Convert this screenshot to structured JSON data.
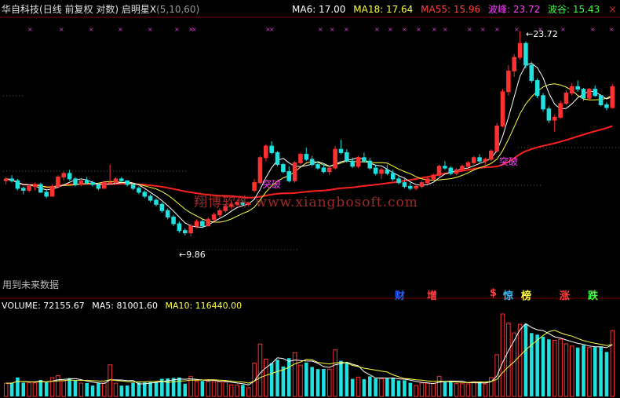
{
  "header": {
    "stock_name": "华自科技",
    "mode": "(日线 前复权 对数)",
    "indicator_name": "启明星X",
    "indicator_params": "(5,10,60)",
    "ma6": "MA6: 17.00",
    "ma18": "MA18: 17.64",
    "ma55": "MA55: 15.96",
    "peak": "波峰: 23.72",
    "trough": "波谷: 15.43"
  },
  "colors": {
    "background": "#000000",
    "up": "#ff3030",
    "down": "#20e0e0",
    "ma55": "#ff2020",
    "ma_short": "#ffffff",
    "ma_mid": "#ffff40",
    "marker": "#d040d0"
  },
  "price_labels": {
    "high": "23.72",
    "low": "9.86",
    "breakout1": "突破",
    "breakout2": "突破"
  },
  "future_note": "用到未来数据",
  "signals": [
    {
      "text": "财",
      "color": "#2060ff"
    },
    {
      "text": "增",
      "color": "#ff4040"
    },
    {
      "text": "$",
      "color": "#ff4040"
    },
    {
      "text": "惊",
      "color": "#40c0ff"
    },
    {
      "text": "榜",
      "color": "#ffff40"
    },
    {
      "text": "涨",
      "color": "#ff4040"
    },
    {
      "text": "跌",
      "color": "#40ff40"
    }
  ],
  "volume": {
    "label": "VOLUME: 72155.67",
    "ma5": "MA5: 81001.60",
    "ma10": "MA10: 116440.00"
  },
  "watermark": "翔博软件 www.xiangbosoft.com",
  "close_icon": "×",
  "chart_data": {
    "type": "candlestick",
    "ylim": [
      9.0,
      25.0
    ],
    "ohlc": [
      [
        12.5,
        12.7,
        12.3,
        12.6
      ],
      [
        12.6,
        12.8,
        12.4,
        12.5
      ],
      [
        12.5,
        12.6,
        12.0,
        12.1
      ],
      [
        12.1,
        12.2,
        11.8,
        12.0
      ],
      [
        12.0,
        12.3,
        11.9,
        12.2
      ],
      [
        12.2,
        12.4,
        12.0,
        12.3
      ],
      [
        12.3,
        12.4,
        11.9,
        11.9
      ],
      [
        11.9,
        12.0,
        11.6,
        11.7
      ],
      [
        11.7,
        12.3,
        11.7,
        12.2
      ],
      [
        12.2,
        12.8,
        12.1,
        12.7
      ],
      [
        12.7,
        13.0,
        12.5,
        12.9
      ],
      [
        12.9,
        13.1,
        12.5,
        12.6
      ],
      [
        12.6,
        12.7,
        12.2,
        12.3
      ],
      [
        12.3,
        12.6,
        12.2,
        12.5
      ],
      [
        12.5,
        12.7,
        12.3,
        12.4
      ],
      [
        12.4,
        12.5,
        12.2,
        12.3
      ],
      [
        12.3,
        12.4,
        12.0,
        12.1
      ],
      [
        12.1,
        12.5,
        12.1,
        12.4
      ],
      [
        12.4,
        13.4,
        12.3,
        12.4
      ],
      [
        12.4,
        12.7,
        12.3,
        12.6
      ],
      [
        12.6,
        12.7,
        12.4,
        12.5
      ],
      [
        12.5,
        12.5,
        12.2,
        12.3
      ],
      [
        12.3,
        12.4,
        12.0,
        12.1
      ],
      [
        12.1,
        12.2,
        11.8,
        11.9
      ],
      [
        11.9,
        12.0,
        11.6,
        11.7
      ],
      [
        11.7,
        11.8,
        11.4,
        11.5
      ],
      [
        11.5,
        11.6,
        11.2,
        11.3
      ],
      [
        11.3,
        11.4,
        10.9,
        11.0
      ],
      [
        11.0,
        11.1,
        10.6,
        10.7
      ],
      [
        10.7,
        10.8,
        10.3,
        10.4
      ],
      [
        10.4,
        10.5,
        10.0,
        10.1
      ],
      [
        10.1,
        10.2,
        9.9,
        10.0
      ],
      [
        10.0,
        10.4,
        9.86,
        10.3
      ],
      [
        10.3,
        10.6,
        10.2,
        10.5
      ],
      [
        10.5,
        10.6,
        10.2,
        10.3
      ],
      [
        10.3,
        10.7,
        10.3,
        10.6
      ],
      [
        10.6,
        10.9,
        10.5,
        10.8
      ],
      [
        10.8,
        11.1,
        10.7,
        11.0
      ],
      [
        11.0,
        11.3,
        10.9,
        11.2
      ],
      [
        11.2,
        11.4,
        11.1,
        11.3
      ],
      [
        11.3,
        11.5,
        11.2,
        11.4
      ],
      [
        11.4,
        11.5,
        11.2,
        11.3
      ],
      [
        11.3,
        11.4,
        11.2,
        11.35
      ],
      [
        12.0,
        12.6,
        11.9,
        12.4
      ],
      [
        12.4,
        13.9,
        12.3,
        13.8
      ],
      [
        13.8,
        14.6,
        13.6,
        14.5
      ],
      [
        14.5,
        14.8,
        14.0,
        14.1
      ],
      [
        14.1,
        14.2,
        13.3,
        13.4
      ],
      [
        13.4,
        13.5,
        12.9,
        13.0
      ],
      [
        13.0,
        13.3,
        12.4,
        12.5
      ],
      [
        12.5,
        13.6,
        12.4,
        13.5
      ],
      [
        13.5,
        14.1,
        13.4,
        14.0
      ],
      [
        14.0,
        14.4,
        13.6,
        13.7
      ],
      [
        13.7,
        13.9,
        13.3,
        13.4
      ],
      [
        13.4,
        13.6,
        13.1,
        13.2
      ],
      [
        13.2,
        13.4,
        12.9,
        13.0
      ],
      [
        13.0,
        13.3,
        12.8,
        13.2
      ],
      [
        13.2,
        14.5,
        13.1,
        14.3
      ],
      [
        14.3,
        14.9,
        14.0,
        14.1
      ],
      [
        14.1,
        14.3,
        13.5,
        13.6
      ],
      [
        13.6,
        13.8,
        13.2,
        13.3
      ],
      [
        13.3,
        13.9,
        13.2,
        13.8
      ],
      [
        13.8,
        14.1,
        13.5,
        13.6
      ],
      [
        13.6,
        13.8,
        13.1,
        13.2
      ],
      [
        13.2,
        13.4,
        12.8,
        12.9
      ],
      [
        12.9,
        13.2,
        12.6,
        13.1
      ],
      [
        13.1,
        13.4,
        12.8,
        12.9
      ],
      [
        12.9,
        13.1,
        12.5,
        12.6
      ],
      [
        12.6,
        12.8,
        12.3,
        12.4
      ],
      [
        12.4,
        12.6,
        12.1,
        12.2
      ],
      [
        12.2,
        12.4,
        12.0,
        12.1
      ],
      [
        12.1,
        12.3,
        12.0,
        12.2
      ],
      [
        12.2,
        12.5,
        12.1,
        12.4
      ],
      [
        12.4,
        12.7,
        12.3,
        12.6
      ],
      [
        12.6,
        12.9,
        12.5,
        12.8
      ],
      [
        12.8,
        13.4,
        12.7,
        13.3
      ],
      [
        13.3,
        13.6,
        13.1,
        13.2
      ],
      [
        13.2,
        13.3,
        12.8,
        12.9
      ],
      [
        12.9,
        13.2,
        12.8,
        13.1
      ],
      [
        13.1,
        13.4,
        13.0,
        13.3
      ],
      [
        13.3,
        13.6,
        13.2,
        13.5
      ],
      [
        13.5,
        13.9,
        13.4,
        13.8
      ],
      [
        13.8,
        14.0,
        13.5,
        13.6
      ],
      [
        13.6,
        13.8,
        13.4,
        13.7
      ],
      [
        13.7,
        14.3,
        13.6,
        14.2
      ],
      [
        14.2,
        16.0,
        14.1,
        15.8
      ],
      [
        15.8,
        18.5,
        15.7,
        18.3
      ],
      [
        18.3,
        20.5,
        18.0,
        20.0
      ],
      [
        20.0,
        21.5,
        19.5,
        21.2
      ],
      [
        21.2,
        23.72,
        21.0,
        22.5
      ],
      [
        22.5,
        22.7,
        20.2,
        20.5
      ],
      [
        20.5,
        20.8,
        19.0,
        19.2
      ],
      [
        19.2,
        19.4,
        17.8,
        18.0
      ],
      [
        18.0,
        18.2,
        16.8,
        17.0
      ],
      [
        17.0,
        17.2,
        16.0,
        16.2
      ],
      [
        16.2,
        16.6,
        15.43,
        16.4
      ],
      [
        16.4,
        17.6,
        16.3,
        17.4
      ],
      [
        17.4,
        18.4,
        17.3,
        18.2
      ],
      [
        18.2,
        19.0,
        18.0,
        18.7
      ],
      [
        18.7,
        19.2,
        18.3,
        18.5
      ],
      [
        18.5,
        18.6,
        17.6,
        17.8
      ],
      [
        17.8,
        18.6,
        17.7,
        18.5
      ],
      [
        18.5,
        18.8,
        17.9,
        18.0
      ],
      [
        18.0,
        18.1,
        17.2,
        17.3
      ],
      [
        17.3,
        17.5,
        16.9,
        17.1
      ],
      [
        17.1,
        18.9,
        17.0,
        18.7
      ]
    ]
  }
}
